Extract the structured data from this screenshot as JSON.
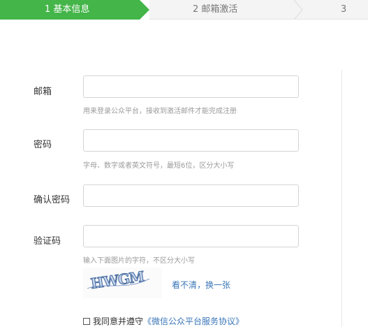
{
  "steps": {
    "step1": "1 基本信息",
    "step2": "2 邮箱激活",
    "step3": "3"
  },
  "form": {
    "email": {
      "label": "邮箱",
      "value": "",
      "hint": "用来登录公众平台，接收到激活邮件才能完成注册"
    },
    "password": {
      "label": "密码",
      "value": "",
      "hint": "字母、数字或者英文符号，最短6位，区分大小写"
    },
    "confirm_password": {
      "label": "确认密码",
      "value": ""
    },
    "captcha": {
      "label": "验证码",
      "value": "",
      "hint": "输入下面图片的字符，不区分大小写",
      "image_text": "HWGM",
      "refresh_label": "看不清，换一张"
    }
  },
  "agreement": {
    "text": "我同意并遵守",
    "link": "《微信公众平台服务协议》",
    "checked": false
  },
  "colors": {
    "accent": "#44b549",
    "link": "#3a76b8"
  }
}
